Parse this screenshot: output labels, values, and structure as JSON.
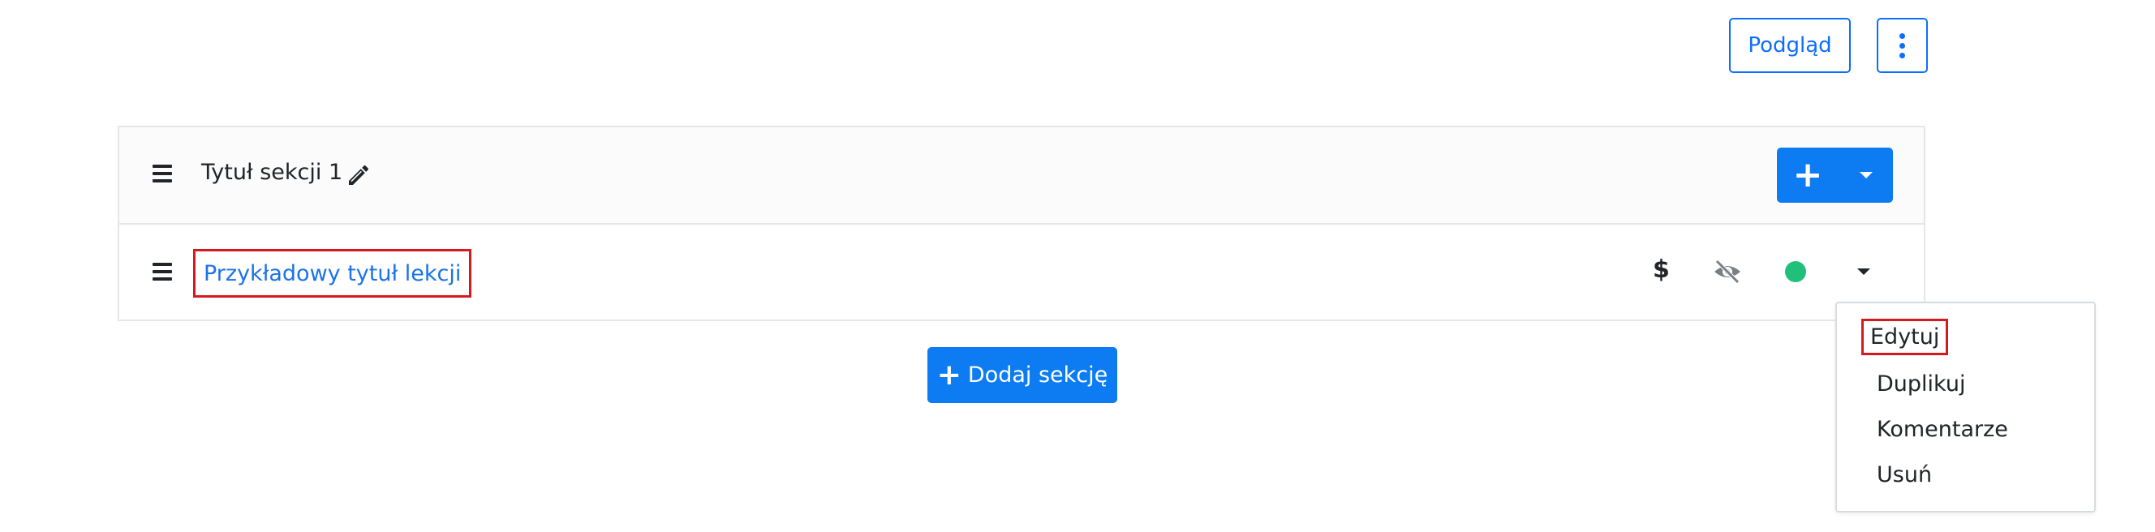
{
  "toolbar": {
    "preview_label": "Podgląd"
  },
  "section": {
    "title": "Tytuł sekcji 1"
  },
  "lesson": {
    "title": "Przykładowy tytuł lekcji",
    "price_symbol": "$",
    "status_color": "#21c07a"
  },
  "add_section_label": "Dodaj sekcję",
  "dropdown": {
    "items": [
      "Edytuj",
      "Duplikuj",
      "Komentarze",
      "Usuń"
    ]
  },
  "colors": {
    "primary": "#0d7cf2",
    "highlight_box": "#d6191e"
  }
}
